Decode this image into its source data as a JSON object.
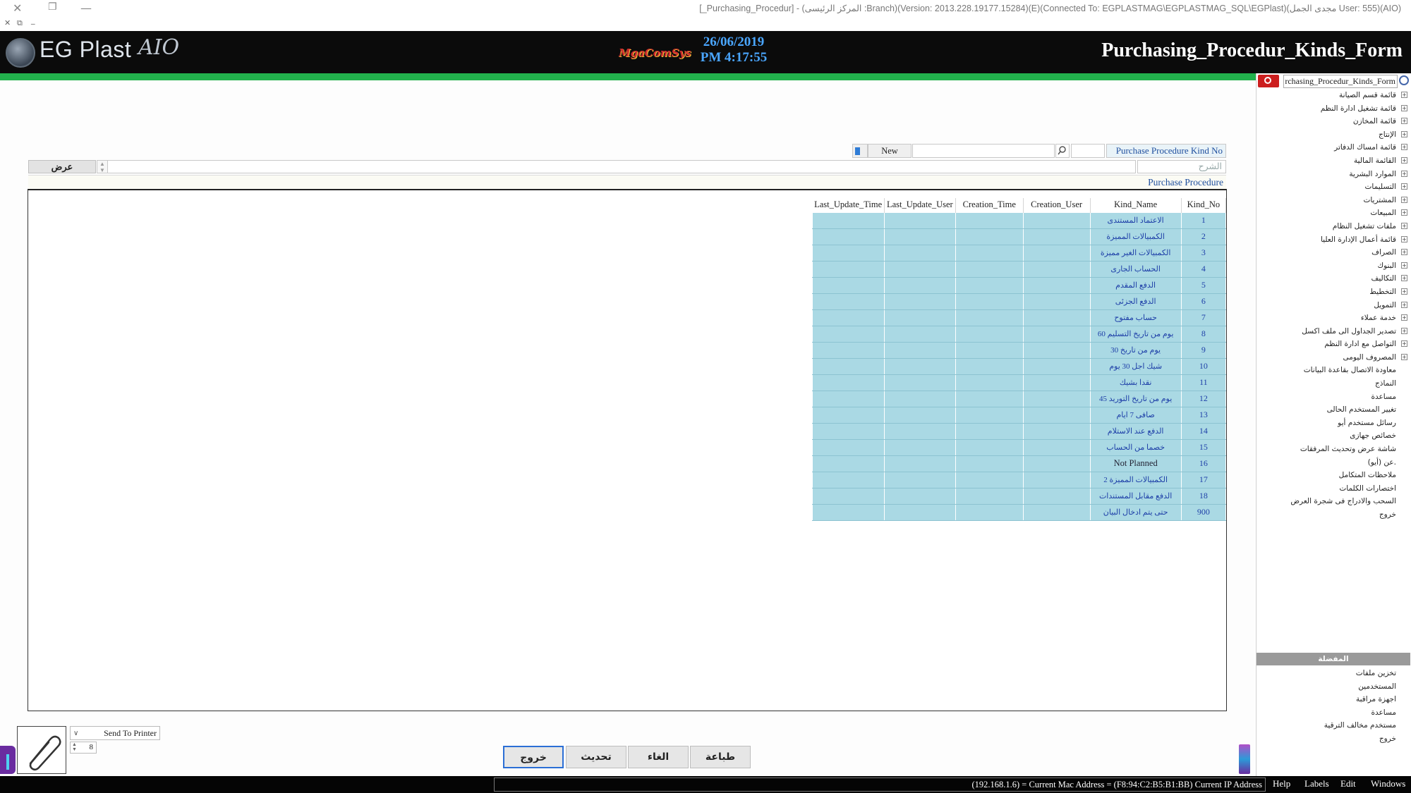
{
  "titlebar": {
    "text": "[_Purchasing_Procedur] - (المركز الرئيسى :Branch)(Version: 2013.228.19177.15284)(E)(Connected To: EGPLASTMAG\\EGPLASTMAG_SQL\\EGPlast)(مجدى الجمل User: 555)(AIO)",
    "close": "✕",
    "restore": "❐",
    "minimize": "—",
    "sub_close": "✕",
    "sub_restore": "⧉",
    "sub_minimize": "_"
  },
  "header": {
    "logo_text": "EG Plast",
    "logo_aio": "AIO",
    "mga_logo": "MgaComSys",
    "date": "26/06/2019",
    "time": "PM 4:17:55",
    "form_title": "Purchasing_Procedur_Kinds_Form"
  },
  "search": {
    "kind_no_label": "Purchase Procedure Kind No",
    "new_label": "New"
  },
  "desc": {
    "label": "الشرح",
    "view_button": "عرض"
  },
  "group_title": "Purchase Procedure",
  "grid": {
    "columns": [
      "Last_Update_Time",
      "Last_Update_User",
      "Creation_Time",
      "Creation_User",
      "Kind_Name",
      "Kind_No"
    ],
    "rows": [
      {
        "kind_no": "1",
        "kind_name": "الاعتماد المستندى"
      },
      {
        "kind_no": "2",
        "kind_name": "الكمبيالات المميزة"
      },
      {
        "kind_no": "3",
        "kind_name": "الكمبيالات الغير مميزة"
      },
      {
        "kind_no": "4",
        "kind_name": "الحساب الجارى"
      },
      {
        "kind_no": "5",
        "kind_name": "الدفع المقدم"
      },
      {
        "kind_no": "6",
        "kind_name": "الدفع الجزئى"
      },
      {
        "kind_no": "7",
        "kind_name": "حساب مفتوح"
      },
      {
        "kind_no": "8",
        "kind_name": "60 يوم من تاريخ التسليم"
      },
      {
        "kind_no": "9",
        "kind_name": "30 يوم من تاريخ"
      },
      {
        "kind_no": "10",
        "kind_name": "شيك اجل 30 يوم"
      },
      {
        "kind_no": "11",
        "kind_name": "نقدا بشيك"
      },
      {
        "kind_no": "12",
        "kind_name": "45 يوم من تاريخ التوريد"
      },
      {
        "kind_no": "13",
        "kind_name": "صافى 7 ايام"
      },
      {
        "kind_no": "14",
        "kind_name": "الدفع عند الاستلام"
      },
      {
        "kind_no": "15",
        "kind_name": "خصما من الحساب"
      },
      {
        "kind_no": "16",
        "kind_name": "Not Planned"
      },
      {
        "kind_no": "17",
        "kind_name": "الكمبيالات المميزة 2"
      },
      {
        "kind_no": "18",
        "kind_name": "الدفع مقابل المستندات"
      },
      {
        "kind_no": "900",
        "kind_name": "حتى يتم ادخال البيان"
      }
    ]
  },
  "bottom": {
    "printer": "Send To Printer",
    "copies": "8",
    "buttons": {
      "exit": "خروج",
      "refresh": "تحديث",
      "cancel": "الغاء",
      "print": "طباعة"
    }
  },
  "statusbar": {
    "address": "(192.168.1.6) = Current Mac Address = (F8:94:C2:B5:B1:BB) Current IP Address",
    "menu": [
      "Help",
      "Labels",
      "Edit",
      "Windows"
    ]
  },
  "tree": {
    "search_value": "rchasing_Procedur_Kinds_Form",
    "items": [
      {
        "label": "قائمة قسم الصيانة",
        "expandable": true
      },
      {
        "label": "قائمة تشغيل ادارة النظم",
        "expandable": true
      },
      {
        "label": "قائمة المخازن",
        "expandable": true
      },
      {
        "label": "الإنتاج",
        "expandable": true
      },
      {
        "label": "قائمة امساك الدفاتر",
        "expandable": true
      },
      {
        "label": "القائمة المالية",
        "expandable": true
      },
      {
        "label": "الموارد البشرية",
        "expandable": true
      },
      {
        "label": "التسليمات",
        "expandable": true
      },
      {
        "label": "المشتريات",
        "expandable": true
      },
      {
        "label": "المبيعات",
        "expandable": true
      },
      {
        "label": "ملفات تشغيل النظام",
        "expandable": true
      },
      {
        "label": "قائمة أعمال الإدارة العليا",
        "expandable": true
      },
      {
        "label": "الصراف",
        "expandable": true
      },
      {
        "label": "البنوك",
        "expandable": true
      },
      {
        "label": "التكاليف",
        "expandable": true
      },
      {
        "label": "التخطيط",
        "expandable": true
      },
      {
        "label": "التمويل",
        "expandable": true
      },
      {
        "label": "خدمة عملاء",
        "expandable": true
      },
      {
        "label": "تصدير الجداول الى ملف اكسل",
        "expandable": true
      },
      {
        "label": "التواصل مع ادارة النظم",
        "expandable": true
      },
      {
        "label": "المصروف اليومى",
        "expandable": true
      },
      {
        "label": "معاودة الاتصال بقاعدة البيانات",
        "expandable": false
      },
      {
        "label": "النماذج",
        "expandable": false
      },
      {
        "label": "مساعدة",
        "expandable": false
      },
      {
        "label": "تغيير المستخدم الحالى",
        "expandable": false
      },
      {
        "label": "رسائل مستخدم أيو",
        "expandable": false
      },
      {
        "label": "خصائص جهازى",
        "expandable": false
      },
      {
        "label": "شاشة عرض وتحديث المرفقات",
        "expandable": false
      },
      {
        "label": "عن (أيو).",
        "expandable": false
      },
      {
        "label": "ملاحظات المتكامل",
        "expandable": false
      },
      {
        "label": "اختصارات الكلمات",
        "expandable": false
      },
      {
        "label": "السحب والادراج فى شجرة العرض",
        "expandable": false
      },
      {
        "label": "خروج",
        "expandable": false
      }
    ],
    "favorites_title": "المفضلة",
    "favorites": [
      "تخزين ملفات",
      "المستخدمين",
      "اجهزة مراقبة",
      "مساعدة",
      "مستخدم مخالف الترقية",
      "خروج"
    ]
  },
  "colors": {
    "header_bg": "#0b0b0b",
    "green_bar": "#22b14c",
    "grid_cell": "#aad9e4",
    "date_blue": "#4aa6ff",
    "search_red": "#cc1e1e"
  }
}
